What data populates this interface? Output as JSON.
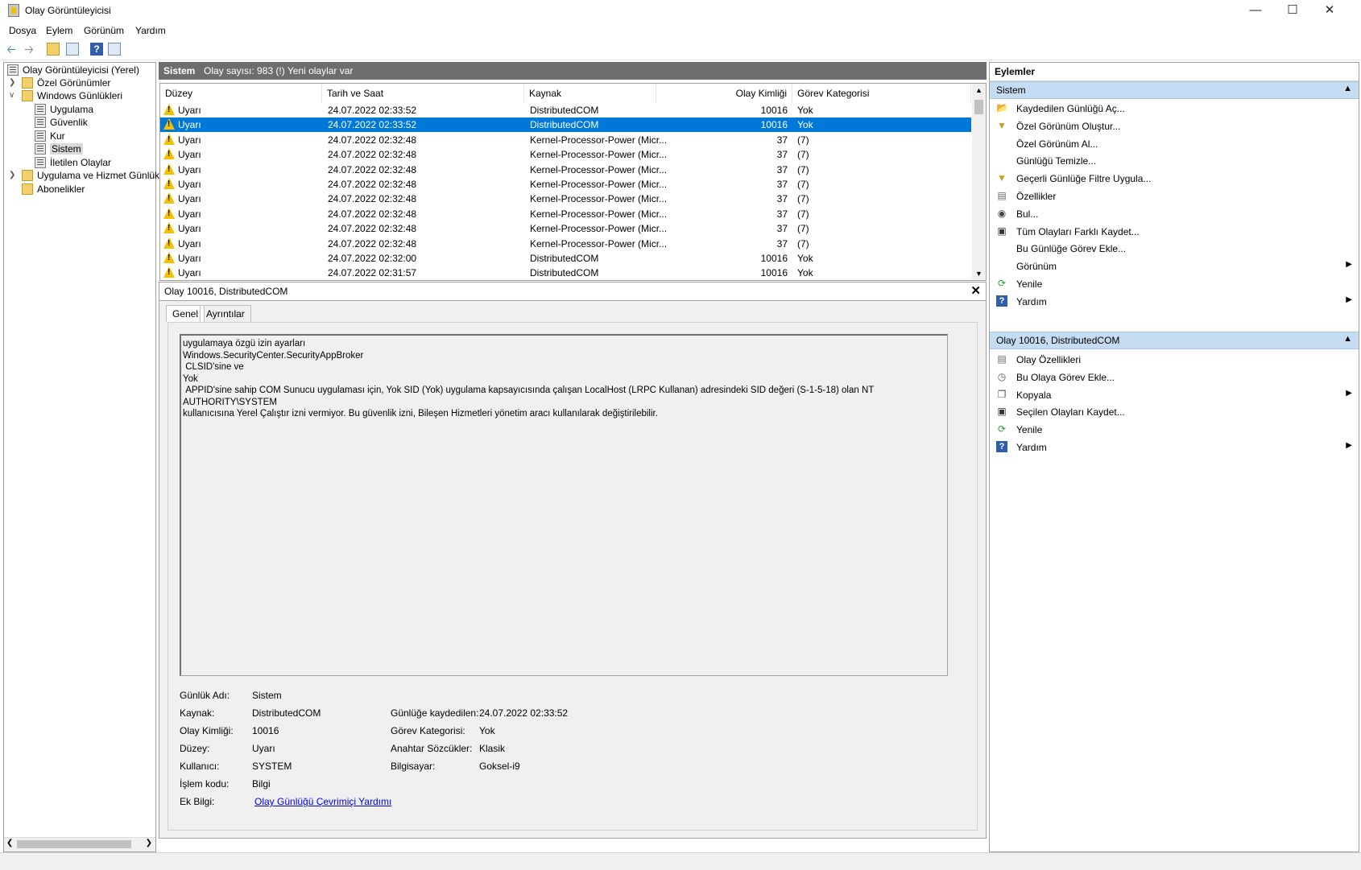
{
  "window": {
    "title": "Olay Görüntüleyicisi",
    "minimize_icon": "minimize-icon",
    "maximize_icon": "maximize-icon",
    "close_icon": "close-icon"
  },
  "menu": [
    "Dosya",
    "Eylem",
    "Görünüm",
    "Yardım"
  ],
  "tree": {
    "root": "Olay Görüntüleyicisi (Yerel)",
    "custom_views": "Özel Görünümler",
    "windows_logs": "Windows Günlükleri",
    "application": "Uygulama",
    "security": "Güvenlik",
    "setup": "Kur",
    "system": "Sistem",
    "forwarded": "İletilen Olaylar",
    "app_service_logs": "Uygulama ve Hizmet Günlük",
    "subscriptions": "Abonelikler"
  },
  "center": {
    "log_name": "Sistem",
    "event_count": "Olay sayısı: 983 (!) Yeni olaylar var"
  },
  "grid": {
    "columns": [
      "Düzey",
      "Tarih ve Saat",
      "Kaynak",
      "Olay Kimliği",
      "Görev Kategorisi"
    ],
    "rows": [
      [
        "Uyarı",
        "24.07.2022 02:33:52",
        "DistributedCOM",
        "10016",
        "Yok"
      ],
      [
        "Uyarı",
        "24.07.2022 02:33:52",
        "DistributedCOM",
        "10016",
        "Yok"
      ],
      [
        "Uyarı",
        "24.07.2022 02:32:48",
        "Kernel-Processor-Power (Micr...",
        "37",
        "(7)"
      ],
      [
        "Uyarı",
        "24.07.2022 02:32:48",
        "Kernel-Processor-Power (Micr...",
        "37",
        "(7)"
      ],
      [
        "Uyarı",
        "24.07.2022 02:32:48",
        "Kernel-Processor-Power (Micr...",
        "37",
        "(7)"
      ],
      [
        "Uyarı",
        "24.07.2022 02:32:48",
        "Kernel-Processor-Power (Micr...",
        "37",
        "(7)"
      ],
      [
        "Uyarı",
        "24.07.2022 02:32:48",
        "Kernel-Processor-Power (Micr...",
        "37",
        "(7)"
      ],
      [
        "Uyarı",
        "24.07.2022 02:32:48",
        "Kernel-Processor-Power (Micr...",
        "37",
        "(7)"
      ],
      [
        "Uyarı",
        "24.07.2022 02:32:48",
        "Kernel-Processor-Power (Micr...",
        "37",
        "(7)"
      ],
      [
        "Uyarı",
        "24.07.2022 02:32:48",
        "Kernel-Processor-Power (Micr...",
        "37",
        "(7)"
      ],
      [
        "Uyarı",
        "24.07.2022 02:32:00",
        "DistributedCOM",
        "10016",
        "Yok"
      ],
      [
        "Uyarı",
        "24.07.2022 02:31:57",
        "DistributedCOM",
        "10016",
        "Yok"
      ]
    ],
    "selected_row": 1
  },
  "detail": {
    "title": "Olay 10016, DistributedCOM",
    "tab_general": "Genel",
    "tab_details": "Ayrıntılar",
    "message": "uygulamaya özgü izin ayarları\nWindows.SecurityCenter.SecurityAppBroker\n CLSID'sine ve\nYok\n APPID'sine sahip COM Sunucu uygulaması için, Yok SID (Yok) uygulama kapsayıcısında çalışan LocalHost (LRPC Kullanan) adresindeki SID değeri (S-1-5-18) olan NT AUTHORITY\\SYSTEM\nkullanıcısına Yerel Çalıştır izni vermiyor. Bu güvenlik izni, Bileşen Hizmetleri yönetim aracı kullanılarak değiştirilebilir.",
    "fields": {
      "log_name_label": "Günlük Adı:",
      "log_name": "Sistem",
      "source_label": "Kaynak:",
      "source": "DistributedCOM",
      "logged_label": "Günlüğe kaydedilen:",
      "logged": "24.07.2022 02:33:52",
      "event_id_label": "Olay Kimliği:",
      "event_id": "10016",
      "task_label": "Görev Kategorisi:",
      "task": "Yok",
      "level_label": "Düzey:",
      "level": "Uyarı",
      "keywords_label": "Anahtar Sözcükler:",
      "keywords": "Klasik",
      "user_label": "Kullanıcı:",
      "user": "SYSTEM",
      "computer_label": "Bilgisayar:",
      "computer": "Goksel-i9",
      "opcode_label": "İşlem kodu:",
      "opcode": "Bilgi",
      "more_info_label": "Ek Bilgi:",
      "more_info_link": "Olay Günlüğü Çevrimiçi Yardımı"
    }
  },
  "actions": {
    "title": "Eylemler",
    "section1": "Sistem",
    "items1": [
      {
        "label": "Kaydedilen Günlüğü Aç...",
        "icon": "open-folder-icon",
        "submenu": false
      },
      {
        "label": "Özel Görünüm Oluştur...",
        "icon": "filter-icon",
        "submenu": false
      },
      {
        "label": "Özel Görünüm Al...",
        "icon": "",
        "submenu": false
      },
      {
        "label": "Günlüğü Temizle...",
        "icon": "",
        "submenu": false
      },
      {
        "label": "Geçerli Günlüğe Filtre Uygula...",
        "icon": "filter-icon",
        "submenu": false
      },
      {
        "label": "Özellikler",
        "icon": "properties-icon",
        "submenu": false
      },
      {
        "label": "Bul...",
        "icon": "binoculars-icon",
        "submenu": false
      },
      {
        "label": "Tüm Olayları Farklı Kaydet...",
        "icon": "save-icon",
        "submenu": false
      },
      {
        "label": "Bu Günlüğe Görev Ekle...",
        "icon": "",
        "submenu": false
      },
      {
        "label": "Görünüm",
        "icon": "",
        "submenu": true
      },
      {
        "label": "Yenile",
        "icon": "refresh-icon",
        "submenu": false
      },
      {
        "label": "Yardım",
        "icon": "help-icon",
        "submenu": true
      }
    ],
    "section2": "Olay 10016, DistributedCOM",
    "items2": [
      {
        "label": "Olay Özellikleri",
        "icon": "properties-icon",
        "submenu": false
      },
      {
        "label": "Bu Olaya Görev Ekle...",
        "icon": "task-icon",
        "submenu": false
      },
      {
        "label": "Kopyala",
        "icon": "copy-icon",
        "submenu": true
      },
      {
        "label": "Seçilen Olayları Kaydet...",
        "icon": "save-icon",
        "submenu": false
      },
      {
        "label": "Yenile",
        "icon": "refresh-icon",
        "submenu": false
      },
      {
        "label": "Yardım",
        "icon": "help-icon",
        "submenu": true
      }
    ]
  }
}
